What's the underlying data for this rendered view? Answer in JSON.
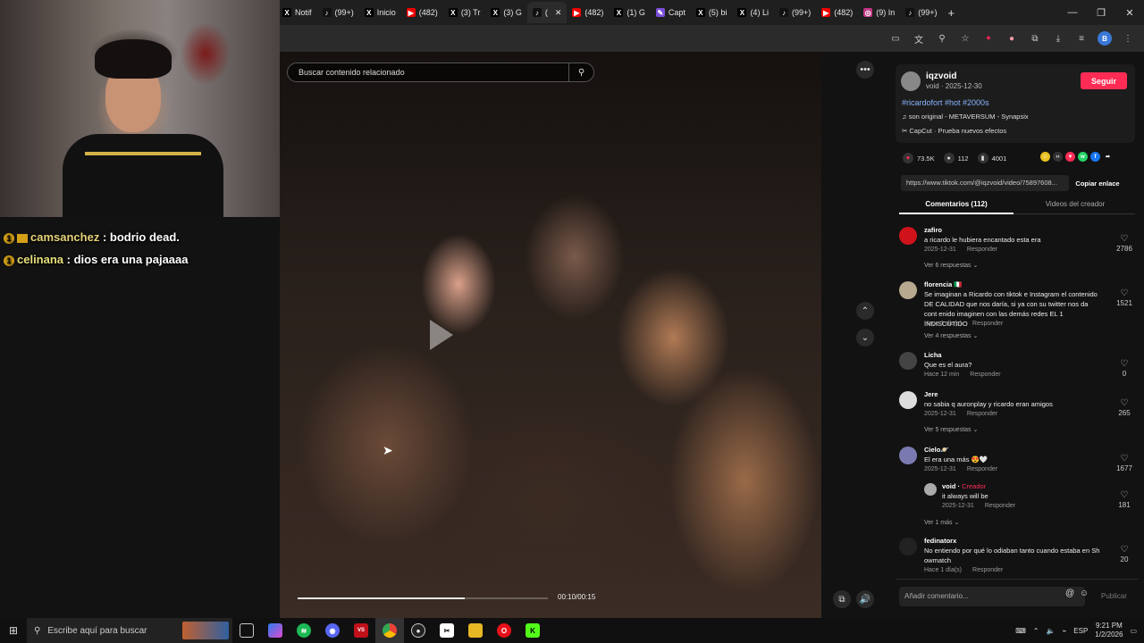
{
  "browser": {
    "tabs": [
      {
        "label": "Notif",
        "icon": "x-icon",
        "fav": "X",
        "color": "#000"
      },
      {
        "label": "(99+)",
        "icon": "tiktok-icon",
        "fav": "♪",
        "color": "#111"
      },
      {
        "label": "Inicio",
        "icon": "x-icon",
        "fav": "X",
        "color": "#000"
      },
      {
        "label": "(482)",
        "icon": "youtube-icon",
        "fav": "▶",
        "color": "#e00"
      },
      {
        "label": "(3) Tr",
        "icon": "x-icon",
        "fav": "X",
        "color": "#000"
      },
      {
        "label": "(3) G",
        "icon": "x-icon",
        "fav": "X",
        "color": "#000"
      },
      {
        "label": "(",
        "icon": "tiktok-icon",
        "fav": "♪",
        "color": "#111",
        "active": true
      },
      {
        "label": "(482)",
        "icon": "youtube-icon",
        "fav": "▶",
        "color": "#e00"
      },
      {
        "label": "(1) G",
        "icon": "x-icon",
        "fav": "X",
        "color": "#000"
      },
      {
        "label": "Capt",
        "icon": "capcut-icon",
        "fav": "✎",
        "color": "#7a4ed8"
      },
      {
        "label": "(5) bi",
        "icon": "x-icon",
        "fav": "X",
        "color": "#000"
      },
      {
        "label": "(4) Li",
        "icon": "x-icon",
        "fav": "X",
        "color": "#000"
      },
      {
        "label": "(99+)",
        "icon": "tiktok-icon",
        "fav": "♪",
        "color": "#111"
      },
      {
        "label": "(482)",
        "icon": "youtube-icon",
        "fav": "▶",
        "color": "#e00"
      },
      {
        "label": "(9) In",
        "icon": "instagram-icon",
        "fav": "◎",
        "color": "#c13584"
      },
      {
        "label": "(99+)",
        "icon": "tiktok-icon",
        "fav": "♪",
        "color": "#111"
      }
    ],
    "profile_initial": "B"
  },
  "video": {
    "search_placeholder": "Buscar contenido relacionado",
    "time": "00:10/00:15",
    "progress": 0.667
  },
  "post": {
    "author": "iqzvoid",
    "author_sub": "void · 2025-12-30",
    "follow_label": "Seguir",
    "hashtags": "#ricardofort #hot #2000s",
    "sound": "son original - METAVERSUM - Synapsix",
    "effect": "CapCut · Prueba nuevos efectos",
    "likes": "73.5K",
    "comments": "112",
    "saves": "4001",
    "url": "https://www.tiktok.com/@iqzvoid/video/75897608...",
    "copy_label": "Copiar enlace",
    "tab_comments": "Comentarios (112)",
    "tab_videos": "Videos del creador"
  },
  "comments": [
    {
      "user": "zafiro",
      "text": "a ricardo le hubiera encantado esta era",
      "date": "2025-12-31",
      "reply": "Responder",
      "likes": "2786",
      "more": "Ver 6 respuestas",
      "avatar_color": "#d0121b"
    },
    {
      "user": "florencia 🇮🇹",
      "text": "Se imaginan a Ricardo con tiktok e Instagram el contenido DE CALIDAD que nos daría, si ya con su twitter nos da cont enido imaginen con las demás redes EL 1 INDISCUTIDO",
      "date": "Hace 1 día(s)",
      "reply": "Responder",
      "likes": "1521",
      "more": "Ver 4 respuestas",
      "avatar_color": "#b8a890"
    },
    {
      "user": "Licha",
      "text": "Que es el aura?",
      "date": "Hace 12 min",
      "reply": "Responder",
      "likes": "0",
      "more": "",
      "avatar_color": "#444"
    },
    {
      "user": "Jere",
      "text": "no sabia q auronplay y ricardo eran amigos",
      "date": "2025-12-31",
      "reply": "Responder",
      "likes": "265",
      "more": "Ver 5 respuestas",
      "avatar_color": "#ddd"
    },
    {
      "user": "Cielo🪐",
      "text": "El era una más 😍🤍",
      "date": "2025-12-31",
      "reply": "Responder",
      "likes": "1677",
      "more": "Ver 1 más",
      "avatar_color": "#7a7ab0"
    },
    {
      "user": "fedinatorx",
      "text": "No entiendo por qué lo odiaban tanto cuando estaba en Sh owmatch",
      "date": "Hace 1 día(s)",
      "reply": "Responder",
      "likes": "20",
      "more": "",
      "avatar_color": "#222"
    }
  ],
  "creator_reply": {
    "user": "void",
    "badge": "Creador",
    "text": "it always will be",
    "date": "2025-12-31",
    "reply": "Responder",
    "likes": "181"
  },
  "compose": {
    "placeholder": "Añadir comentario...",
    "publish": "Publicar"
  },
  "chat": [
    {
      "user": "camsanchez",
      "message": ": bodrio dead."
    },
    {
      "user": "celinana",
      "message": ": dios era una pajaaaa"
    }
  ],
  "taskbar": {
    "search_placeholder": "Escribe aquí para buscar",
    "lang": "ESP",
    "time": "9:21 PM",
    "date": "1/2/2026"
  }
}
